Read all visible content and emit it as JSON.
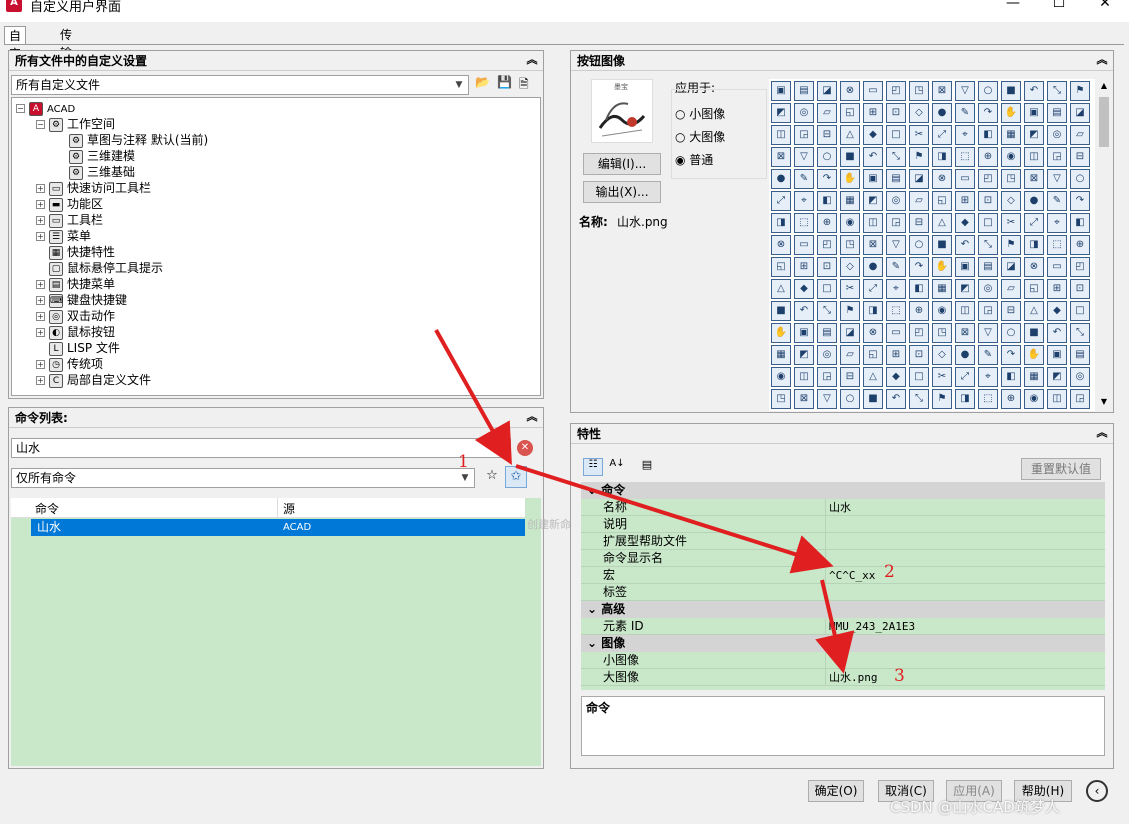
{
  "window": {
    "title": "自定义用户界面",
    "minimize": "—",
    "maximize": "☐",
    "close": "✕"
  },
  "tabs": [
    "自定义",
    "传输"
  ],
  "all_settings_panel": {
    "header": "所有文件中的自定义设置",
    "file_combo": "所有自定义文件",
    "tree": [
      {
        "label": "ACAD",
        "level": 0,
        "exp": "−",
        "icon": "acad-icon"
      },
      {
        "label": "工作空间",
        "level": 1,
        "exp": "−",
        "icon": "gear-icon"
      },
      {
        "label": "草图与注释 默认(当前)",
        "level": 2,
        "exp": "",
        "icon": "gear-icon"
      },
      {
        "label": "三维建模",
        "level": 2,
        "exp": "",
        "icon": "gear-icon"
      },
      {
        "label": "三维基础",
        "level": 2,
        "exp": "",
        "icon": "gear-icon"
      },
      {
        "label": "快速访问工具栏",
        "level": 1,
        "exp": "+",
        "icon": "toolbar-icon"
      },
      {
        "label": "功能区",
        "level": 1,
        "exp": "+",
        "icon": "ribbon-icon"
      },
      {
        "label": "工具栏",
        "level": 1,
        "exp": "+",
        "icon": "toolbar-icon"
      },
      {
        "label": "菜单",
        "level": 1,
        "exp": "+",
        "icon": "menu-icon"
      },
      {
        "label": "快捷特性",
        "level": 1,
        "exp": "",
        "icon": "quick-properties-icon"
      },
      {
        "label": "鼠标悬停工具提示",
        "level": 1,
        "exp": "",
        "icon": "tooltip-icon"
      },
      {
        "label": "快捷菜单",
        "level": 1,
        "exp": "+",
        "icon": "shortcut-menu-icon"
      },
      {
        "label": "键盘快捷键",
        "level": 1,
        "exp": "+",
        "icon": "keyboard-icon"
      },
      {
        "label": "双击动作",
        "level": 1,
        "exp": "+",
        "icon": "double-click-icon"
      },
      {
        "label": "鼠标按钮",
        "level": 1,
        "exp": "+",
        "icon": "mouse-icon"
      },
      {
        "label": "LISP 文件",
        "level": 1,
        "exp": "",
        "icon": "lisp-icon"
      },
      {
        "label": "传统项",
        "level": 1,
        "exp": "+",
        "icon": "legacy-icon"
      },
      {
        "label": "局部自定义文件",
        "level": 1,
        "exp": "+",
        "icon": "cui-icon"
      }
    ]
  },
  "command_list_panel": {
    "header": "命令列表:",
    "search_value": "山水",
    "filter_combo": "仅所有命令",
    "columns": [
      "命令",
      "源"
    ],
    "rows": [
      {
        "command": "山水",
        "source": "ACAD"
      }
    ],
    "ghost_tooltip": "创建新命令"
  },
  "button_image_panel": {
    "header": "按钮图像",
    "apply_to_label": "应用于:",
    "radios": [
      "小图像",
      "大图像",
      "普通"
    ],
    "selected_radio": "普通",
    "edit_button": "编辑(I)...",
    "export_button": "输出(X)...",
    "name_label": "名称:",
    "name_value": "山水.png",
    "preview_caption": "墨宝"
  },
  "properties_panel": {
    "header": "特性",
    "reset_button": "重置默认值",
    "categories": [
      {
        "name": "命令",
        "rows": [
          {
            "key": "名称",
            "value": "山水"
          },
          {
            "key": "说明",
            "value": ""
          },
          {
            "key": "扩展型帮助文件",
            "value": ""
          },
          {
            "key": "命令显示名",
            "value": ""
          },
          {
            "key": "宏",
            "value": "^C^C_xx"
          },
          {
            "key": "标签",
            "value": ""
          }
        ]
      },
      {
        "name": "高级",
        "rows": [
          {
            "key": "元素 ID",
            "value": "MMU_243_2A1E3"
          }
        ]
      },
      {
        "name": "图像",
        "rows": [
          {
            "key": "小图像",
            "value": ""
          },
          {
            "key": "大图像",
            "value": "山水.png"
          }
        ]
      }
    ],
    "description_title": "命令"
  },
  "footer": {
    "ok": "确定(O)",
    "cancel": "取消(C)",
    "apply": "应用(A)",
    "help": "帮助(H)"
  },
  "annotations": [
    "1",
    "2",
    "3"
  ],
  "watermark": "CSDN @山水CAD筑梦人",
  "colors": {
    "arrow": "#e02020",
    "selection": "#0078d7",
    "green": "#c9e7c9"
  }
}
